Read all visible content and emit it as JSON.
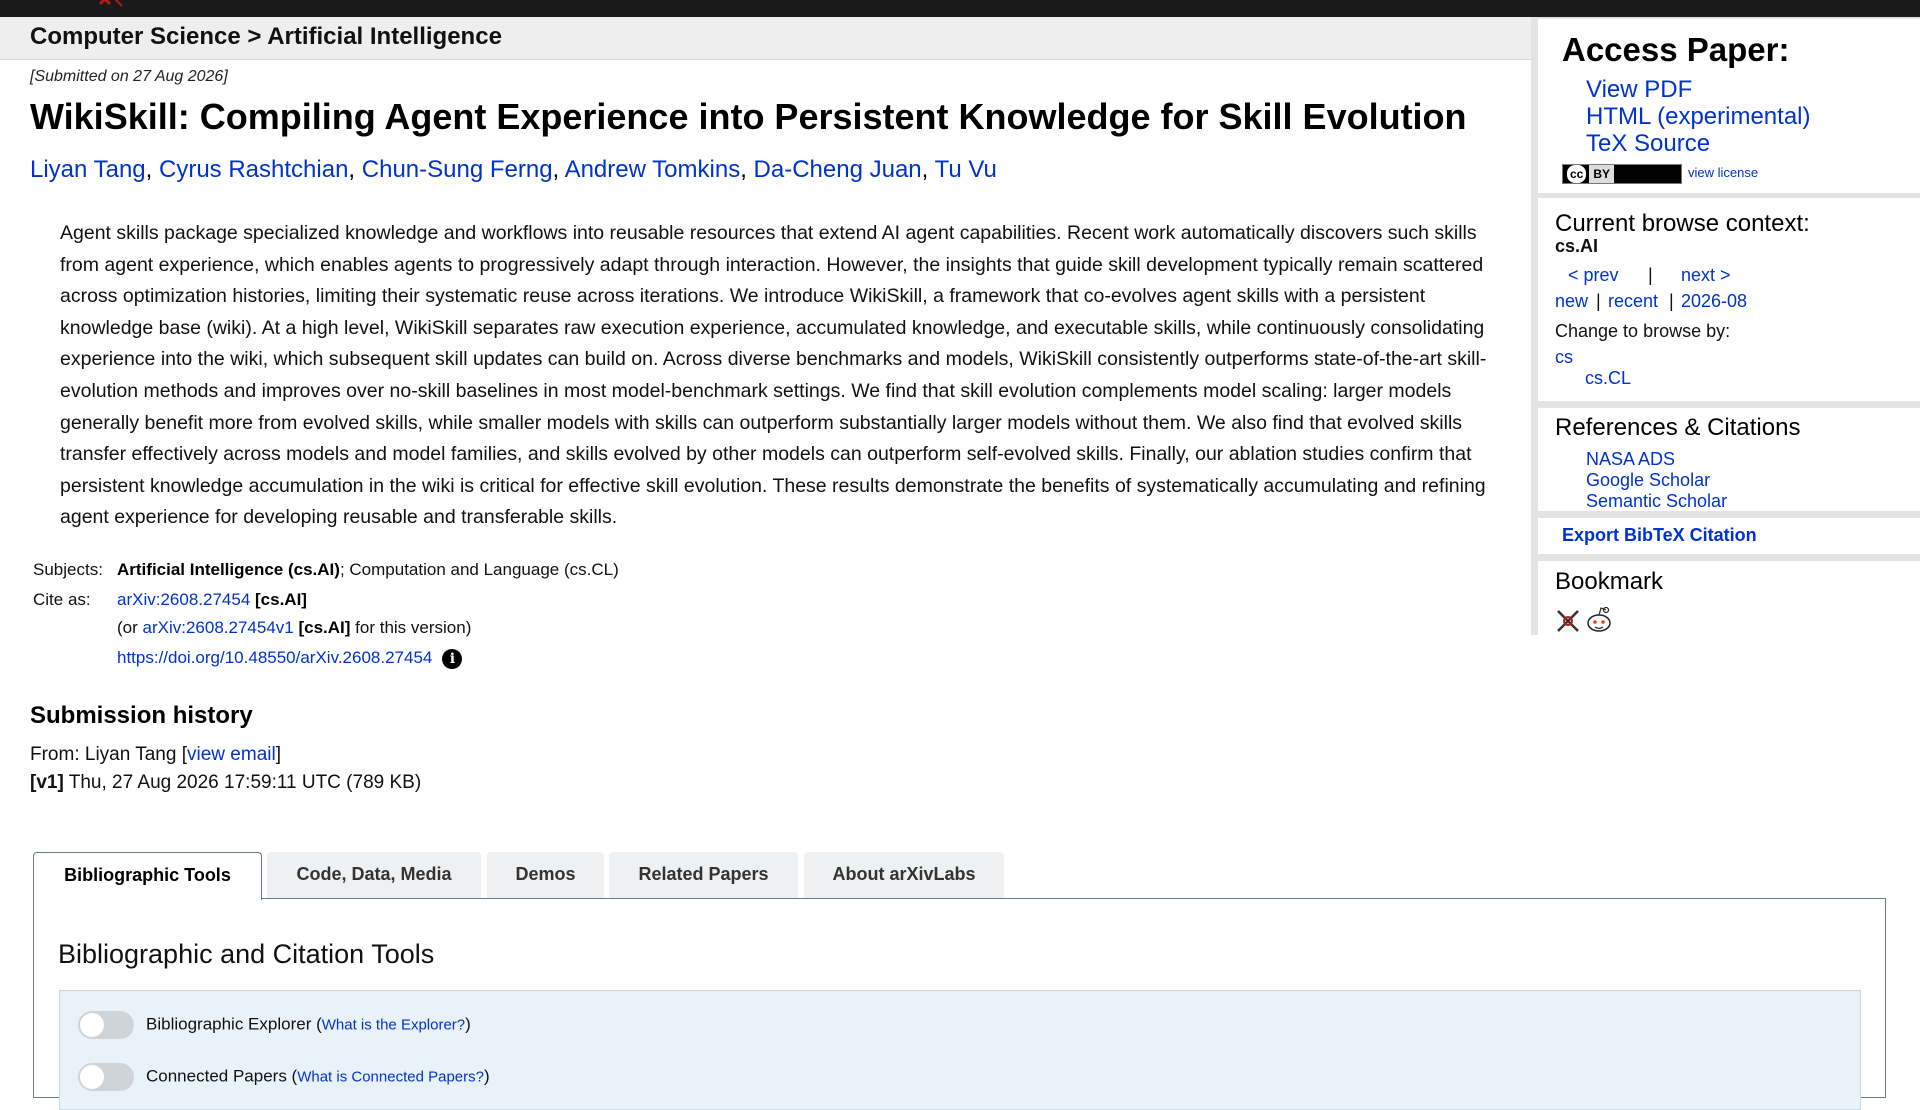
{
  "breadcrumb": "Computer Science > Artificial Intelligence",
  "paper": {
    "submitted": "[Submitted on 27 Aug 2026]",
    "title": "WikiSkill: Compiling Agent Experience into Persistent Knowledge for Skill Evolution",
    "authors": [
      "Liyan Tang",
      "Cyrus Rashtchian",
      "Chun-Sung Ferng",
      "Andrew Tomkins",
      "Da-Cheng Juan",
      "Tu Vu"
    ],
    "author_sep": ",",
    "abstract": "Agent skills package specialized knowledge and workflows into reusable resources that extend AI agent capabilities. Recent work automatically discovers such skills from agent experience, which enables agents to progressively adapt through interaction. However, the insights that guide skill development typically remain scattered across optimization histories, limiting their systematic reuse across iterations. We introduce WikiSkill, a framework that co-evolves agent skills with a persistent knowledge base (wiki). At a high level, WikiSkill separates raw execution experience, accumulated knowledge, and executable skills, while continuously consolidating experience into the wiki, which subsequent skill updates can build on. Across diverse benchmarks and models, WikiSkill consistently outperforms state-of-the-art skill-evolution methods and improves over no-skill baselines in most model-benchmark settings. We find that skill evolution complements model scaling: larger models generally benefit more from evolved skills, while smaller models with skills can outperform substantially larger models without them. We also find that evolved skills transfer effectively across models and model families, and skills evolved by other models can outperform self-evolved skills. Finally, our ablation studies confirm that persistent knowledge accumulation in the wiki is critical for effective skill evolution. These results demonstrate the benefits of systematically accumulating and refining agent experience for developing reusable and transferable skills."
  },
  "meta": {
    "subjects_label": "Subjects:",
    "subject_primary": "Artificial Intelligence (cs.AI)",
    "subject_rest": "; Computation and Language (cs.CL)",
    "cite_label": "Cite as:",
    "cite_id": "arXiv:2608.27454",
    "cite_cat": "[cs.AI]",
    "version_prefix": "(or ",
    "version_id": "arXiv:2608.27454v1",
    "version_cat": "[cs.AI]",
    "version_suffix": " for this version)",
    "doi": "https://doi.org/10.48550/arXiv.2608.27454",
    "info_icon": "i"
  },
  "history": {
    "heading": "Submission history",
    "from_prefix": "From: Liyan Tang [",
    "view_email": "view email",
    "from_suffix": "]",
    "v1_tag": "[v1]",
    "v1_text": " Thu, 27 Aug 2026 17:59:11 UTC (789 KB)"
  },
  "tabs": [
    "Bibliographic Tools",
    "Code, Data, Media",
    "Demos",
    "Related Papers",
    "About arXivLabs"
  ],
  "panel": {
    "heading": "Bibliographic and Citation Tools",
    "tools": [
      {
        "label": "Bibliographic Explorer (",
        "link": "What is the Explorer?",
        "suffix": ")"
      },
      {
        "label": "Connected Papers (",
        "link": "What is Connected Papers?",
        "suffix": ")"
      }
    ]
  },
  "sidebar": {
    "access_heading": "Access Paper:",
    "access_links": [
      "View PDF",
      "HTML (experimental)",
      "TeX Source"
    ],
    "license_badge_cc": "cc",
    "license_badge_by": "BY",
    "view_license": "view license",
    "browse_heading": "Current browse context:",
    "browse_context": "cs.AI",
    "prev": "< prev",
    "browse_sep": "|",
    "next": "next >",
    "new": "new",
    "recent": "recent",
    "date": "2026-08",
    "change_label": "Change to browse by:",
    "cs": "cs",
    "cs_cl": "cs.CL",
    "refs_heading": "References & Citations",
    "refs_links": [
      "NASA ADS",
      "Google Scholar",
      "Semantic Scholar"
    ],
    "export": "Export BibTeX Citation",
    "bookmark_heading": "Bookmark",
    "bookmark_icons": [
      "science-wise-icon",
      "reddit-icon"
    ]
  },
  "colors": {
    "link": "#0033cc",
    "topbar": "#1a1a1a",
    "header_bg": "#eeeeee",
    "tool_box_bg": "#e9f2f8"
  }
}
